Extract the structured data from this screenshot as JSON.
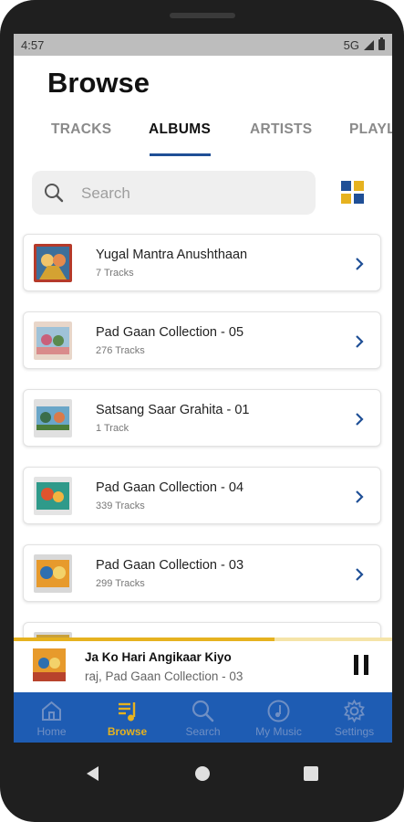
{
  "status_bar": {
    "time": "4:57",
    "network": "5G"
  },
  "page_title": "Browse",
  "tabs": [
    {
      "label": "TRACKS",
      "active": false
    },
    {
      "label": "ALBUMS",
      "active": true
    },
    {
      "label": "ARTISTS",
      "active": false
    },
    {
      "label": "PLAYL",
      "active": false
    }
  ],
  "search": {
    "placeholder": "Search",
    "icon": "search-icon"
  },
  "view_toggle": {
    "icon": "grid-view-icon",
    "colors": [
      "#1f4f96",
      "#e6b21f"
    ]
  },
  "albums": [
    {
      "title": "Yugal Mantra Anushthaan",
      "tracks": "7 Tracks"
    },
    {
      "title": "Pad Gaan Collection - 05",
      "tracks": "276 Tracks"
    },
    {
      "title": "Satsang Saar Grahita - 01",
      "tracks": "1 Track"
    },
    {
      "title": "Pad Gaan Collection - 04",
      "tracks": "339 Tracks"
    },
    {
      "title": "Pad Gaan Collection - 03",
      "tracks": "299 Tracks"
    }
  ],
  "now_playing": {
    "title": "Ja Ko Hari Angikaar Kiyo",
    "subtitle": "raj, Pad Gaan Collection - 03",
    "progress": 0.69,
    "control_icon": "pause-icon"
  },
  "bottom_nav": [
    {
      "label": "Home",
      "icon": "home-icon",
      "active": false
    },
    {
      "label": "Browse",
      "icon": "browse-icon",
      "active": true
    },
    {
      "label": "Search",
      "icon": "search-icon",
      "active": false
    },
    {
      "label": "My Music",
      "icon": "music-note-icon",
      "active": false
    },
    {
      "label": "Settings",
      "icon": "settings-gear-icon",
      "active": false
    }
  ],
  "colors": {
    "accent": "#1e5cb3",
    "highlight": "#e6b21f",
    "tab_indicator": "#1f4f96"
  }
}
